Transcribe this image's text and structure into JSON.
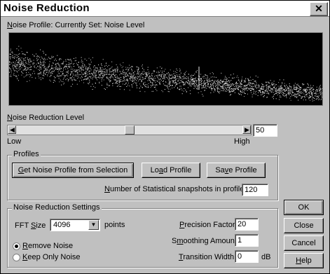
{
  "window": {
    "title": "Noise Reduction",
    "close_glyph": "✕"
  },
  "profile": {
    "caption_pre": "N",
    "caption_rest": "oise Profile: Currently Set: Noise Level"
  },
  "level": {
    "label_pre": "N",
    "label_rest": "oise Reduction Level",
    "value": "50",
    "slider_fraction": 0.5,
    "low": "Low",
    "high": "High"
  },
  "profiles_group": {
    "title": "Profiles",
    "get_button_pre": "G",
    "get_button_rest": "et Noise Profile from Selection",
    "load_button_pre": "Lo",
    "load_button_u": "a",
    "load_button_rest": "d Profile",
    "save_button_pre": "Sa",
    "save_button_u": "v",
    "save_button_rest": "e Profile",
    "snapshots_label_pre": "N",
    "snapshots_label_rest": "umber of Statistical snapshots in profile",
    "snapshots_value": "120"
  },
  "settings_group": {
    "title": "Noise Reduction Settings",
    "fft_label_pre": "FFT ",
    "fft_label_u": "S",
    "fft_label_rest": "ize",
    "fft_value": "4096",
    "fft_unit": "points",
    "radio_remove_pre": "R",
    "radio_remove_rest": "emove Noise",
    "radio_keep_pre": "K",
    "radio_keep_rest": "eep Only Noise",
    "precision_label_pre": "P",
    "precision_label_rest": "recision Factor",
    "precision_value": "20",
    "smoothing_label_pre": "S",
    "smoothing_label_u": "m",
    "smoothing_label_rest": "oothing Amount",
    "smoothing_value": "1",
    "transition_label_pre": "T",
    "transition_label_rest": "ransition Width",
    "transition_value": "0",
    "transition_unit": "dB"
  },
  "actions": {
    "ok": "OK",
    "close": "Close",
    "cancel": "Cancel",
    "help_pre": "H",
    "help_rest": "elp"
  }
}
